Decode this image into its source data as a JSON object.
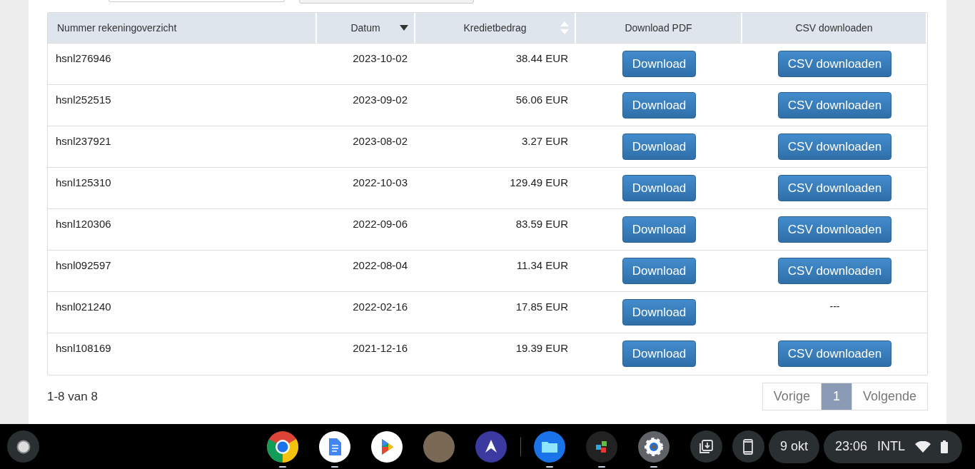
{
  "table": {
    "columns": [
      {
        "label": "Nummer rekeningoverzicht"
      },
      {
        "label": "Datum",
        "sorted": true
      },
      {
        "label": "Kredietbedrag",
        "sorted": false
      },
      {
        "label": "Download PDF"
      },
      {
        "label": "CSV downloaden"
      }
    ],
    "rows": [
      {
        "number": "hsnl276946",
        "date": "2023-10-02",
        "amount": "38.44 EUR",
        "pdf": "Download",
        "csv": {
          "kind": "button",
          "label": "CSV downloaden"
        }
      },
      {
        "number": "hsnl252515",
        "date": "2023-09-02",
        "amount": "56.06 EUR",
        "pdf": "Download",
        "csv": {
          "kind": "button",
          "label": "CSV downloaden"
        }
      },
      {
        "number": "hsnl237921",
        "date": "2023-08-02",
        "amount": "3.27 EUR",
        "pdf": "Download",
        "csv": {
          "kind": "button",
          "label": "CSV downloaden"
        }
      },
      {
        "number": "hsnl125310",
        "date": "2022-10-03",
        "amount": "129.49 EUR",
        "pdf": "Download",
        "csv": {
          "kind": "button",
          "label": "CSV downloaden"
        }
      },
      {
        "number": "hsnl120306",
        "date": "2022-09-06",
        "amount": "83.59 EUR",
        "pdf": "Download",
        "csv": {
          "kind": "button",
          "label": "CSV downloaden"
        }
      },
      {
        "number": "hsnl092597",
        "date": "2022-08-04",
        "amount": "11.34 EUR",
        "pdf": "Download",
        "csv": {
          "kind": "button",
          "label": "CSV downloaden"
        }
      },
      {
        "number": "hsnl021240",
        "date": "2022-02-16",
        "amount": "17.85 EUR",
        "pdf": "Download",
        "csv": {
          "kind": "text",
          "label": "---"
        }
      },
      {
        "number": "hsnl108169",
        "date": "2021-12-16",
        "amount": "19.39 EUR",
        "pdf": "Download",
        "csv": {
          "kind": "button",
          "label": "CSV downloaden"
        }
      }
    ]
  },
  "footer": {
    "summary": "1-8 van 8",
    "pagination": [
      {
        "label": "Vorige",
        "selected": false
      },
      {
        "label": "1",
        "selected": true
      },
      {
        "label": "Volgende",
        "selected": false
      }
    ]
  },
  "shelf": {
    "apps": [
      {
        "kind": "chrome",
        "open": true
      },
      {
        "kind": "docs",
        "open": true
      },
      {
        "kind": "play",
        "open": false
      },
      {
        "kind": "portrait",
        "open": false
      },
      {
        "kind": "creature",
        "open": false
      },
      {
        "kind": "divider"
      },
      {
        "kind": "files",
        "open": true
      },
      {
        "kind": "cubes",
        "open": true
      },
      {
        "kind": "settings",
        "open": true
      }
    ],
    "date": "9 okt",
    "time": "23:06",
    "input_method": "INTL"
  }
}
